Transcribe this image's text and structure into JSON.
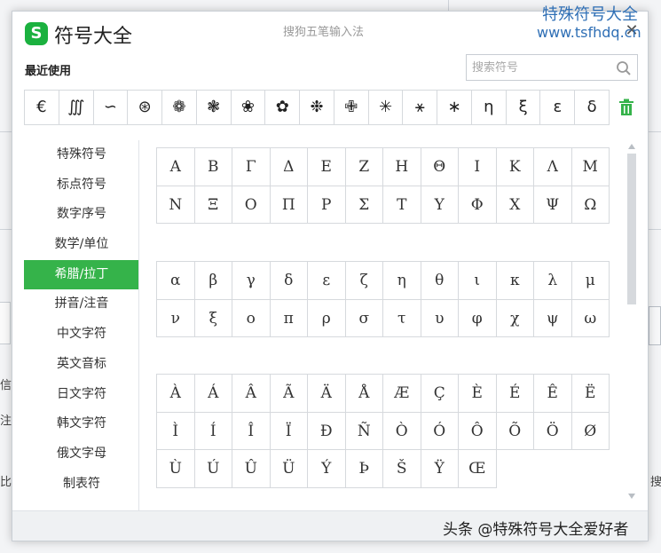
{
  "background": {
    "fragments": [
      "信",
      "注",
      "比",
      "搜"
    ]
  },
  "titlebar": {
    "app_title": "符号大全",
    "ime_name": "搜狗五笔输入法",
    "close_symbol": "✕"
  },
  "watermark": {
    "title": "特殊符号大全",
    "url": "www.tsfhdq.cn",
    "bottom": "头条 @特殊符号大全爱好者"
  },
  "recent": {
    "label": "最近使用",
    "symbols": [
      "€",
      "∭",
      "∽",
      "⊛",
      "❁",
      "❃",
      "❀",
      "✿",
      "❉",
      "✙",
      "✳",
      "⚹",
      "∗",
      "η",
      "ξ",
      "ε",
      "δ"
    ]
  },
  "search": {
    "placeholder": "搜索符号"
  },
  "categories": [
    {
      "label": "特殊符号",
      "active": false
    },
    {
      "label": "标点符号",
      "active": false
    },
    {
      "label": "数字序号",
      "active": false
    },
    {
      "label": "数学/单位",
      "active": false
    },
    {
      "label": "希腊/拉丁",
      "active": true
    },
    {
      "label": "拼音/注音",
      "active": false
    },
    {
      "label": "中文字符",
      "active": false
    },
    {
      "label": "英文音标",
      "active": false
    },
    {
      "label": "日文字符",
      "active": false
    },
    {
      "label": "韩文字符",
      "active": false
    },
    {
      "label": "俄文字母",
      "active": false
    },
    {
      "label": "制表符",
      "active": false
    }
  ],
  "grids": {
    "greek_upper": [
      "Α",
      "Β",
      "Γ",
      "Δ",
      "Ε",
      "Ζ",
      "Η",
      "Θ",
      "Ι",
      "Κ",
      "Λ",
      "Μ",
      "Ν",
      "Ξ",
      "Ο",
      "Π",
      "Ρ",
      "Σ",
      "Τ",
      "Υ",
      "Φ",
      "Χ",
      "Ψ",
      "Ω"
    ],
    "greek_lower": [
      "α",
      "β",
      "γ",
      "δ",
      "ε",
      "ζ",
      "η",
      "θ",
      "ι",
      "κ",
      "λ",
      "μ",
      "ν",
      "ξ",
      "ο",
      "π",
      "ρ",
      "σ",
      "τ",
      "υ",
      "φ",
      "χ",
      "ψ",
      "ω"
    ],
    "latin_upper": [
      "À",
      "Á",
      "Â",
      "Ã",
      "Ä",
      "Å",
      "Æ",
      "Ç",
      "È",
      "É",
      "Ê",
      "Ë",
      "Ì",
      "Í",
      "Î",
      "Ï",
      "Ð",
      "Ñ",
      "Ò",
      "Ó",
      "Ô",
      "Õ",
      "Ö",
      "Ø",
      "Ù",
      "Ú",
      "Û",
      "Ü",
      "Ý",
      "Þ",
      "Š",
      "Ÿ",
      "Œ"
    ]
  },
  "colors": {
    "accent_green": "#35b34a",
    "watermark_blue": "#2f6fb5"
  }
}
